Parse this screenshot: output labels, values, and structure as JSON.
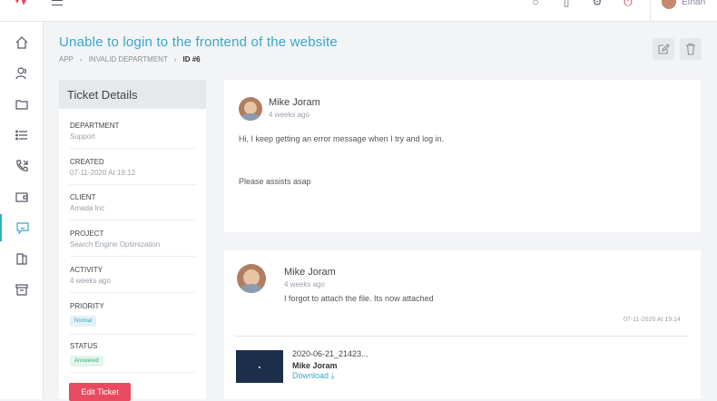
{
  "topbar": {
    "user_name": "Ethan",
    "icons": [
      "bell-icon",
      "tablet-icon",
      "gear-icon",
      "power-icon"
    ]
  },
  "sidebar": {
    "items": [
      {
        "icon": "home-icon"
      },
      {
        "icon": "users-icon"
      },
      {
        "icon": "folder-icon"
      },
      {
        "icon": "list-icon"
      },
      {
        "icon": "phone-icon"
      },
      {
        "icon": "wallet-icon"
      },
      {
        "icon": "chat-icon",
        "active": true
      },
      {
        "icon": "documents-icon"
      },
      {
        "icon": "archive-icon"
      }
    ]
  },
  "page": {
    "title": "Unable to login to the frontend of the website",
    "breadcrumbs": [
      "APP",
      "INVALID DEPARTMENT",
      "ID #6"
    ]
  },
  "details": {
    "header": "Ticket Details",
    "fields": [
      {
        "label": "DEPARTMENT",
        "value": "Support"
      },
      {
        "label": "CREATED",
        "value": "07-11-2020 At 19:12"
      },
      {
        "label": "CLIENT",
        "value": "Amada Inc"
      },
      {
        "label": "PROJECT",
        "value": "Search Engine Optimization"
      },
      {
        "label": "ACTIVITY",
        "value": "4 weeks ago"
      }
    ],
    "priority": {
      "label": "PRIORITY",
      "badge": "Normal"
    },
    "status": {
      "label": "STATUS",
      "badge": "Answered"
    },
    "edit_button": "Edit Ticket"
  },
  "messages": [
    {
      "author": "Mike Joram",
      "ago": "4 weeks ago",
      "line1": "Hi, I keep getting an error message when I try and log in.",
      "line2": "Please assists asap"
    },
    {
      "author": "Mike Joram",
      "ago": "4 weeks ago",
      "text": "I forgot to attach the file. Its now attached",
      "timestamp": "07-11-2020 At 19:14",
      "attachment": {
        "file_name": "2020-06-21_21423...",
        "author": "Mike Joram",
        "download_label": "Download ⤓"
      }
    }
  ],
  "colors": {
    "accent": "#3aa6c8",
    "danger": "#e84a5f",
    "sidebar_bg": "#ffffff",
    "page_bg": "#f3f4f6"
  }
}
